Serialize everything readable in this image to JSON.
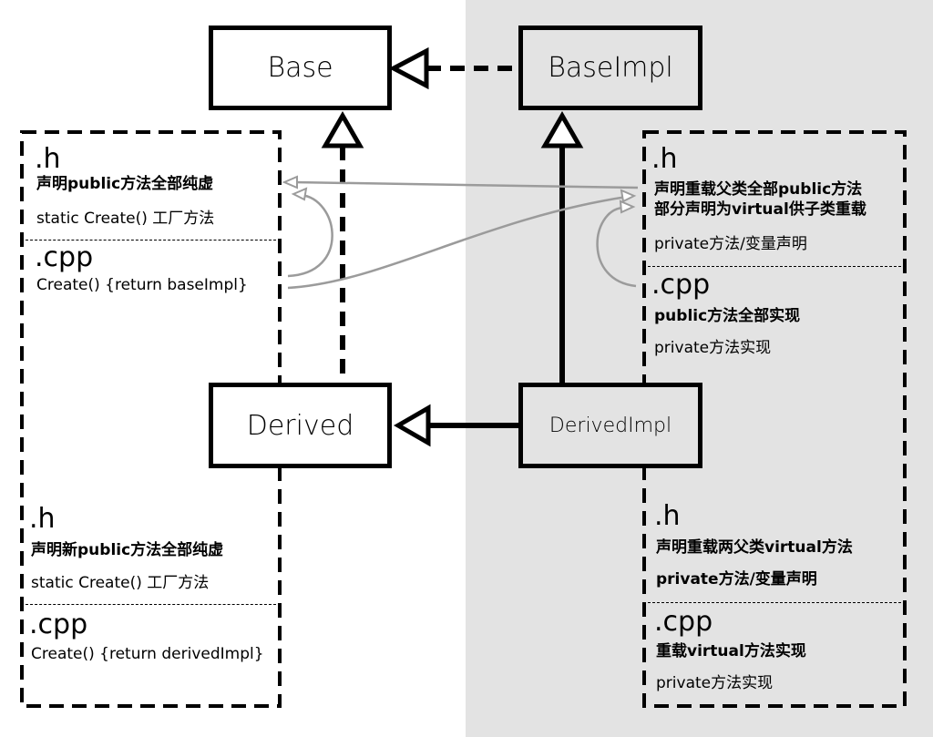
{
  "classes": {
    "base": "Base",
    "base_impl": "BaseImpl",
    "derived": "Derived",
    "derived_impl": "DerivedImpl"
  },
  "base_note": {
    "h_ext": ".h",
    "h_line1": "声明public方法全部纯虚",
    "h_line2": "static Create() 工厂方法",
    "cpp_ext": ".cpp",
    "cpp_line1": "Create() {return baseImpl}"
  },
  "base_impl_note": {
    "h_ext": ".h",
    "h_line1": "声明重载父类全部public方法",
    "h_line2": "部分声明为virtual供子类重载",
    "h_line3": "private方法/变量声明",
    "cpp_ext": ".cpp",
    "cpp_line1": "public方法全部实现",
    "cpp_line2": "private方法实现"
  },
  "derived_note": {
    "h_ext": ".h",
    "h_line1": "声明新public方法全部纯虚",
    "h_line2": "static Create() 工厂方法",
    "cpp_ext": ".cpp",
    "cpp_line1": "Create() {return derivedImpl}"
  },
  "derived_impl_note": {
    "h_ext": ".h",
    "h_line1": "声明重载两父类virtual方法",
    "h_line2": "private方法/变量声明",
    "cpp_ext": ".cpp",
    "cpp_line1": "重载virtual方法实现",
    "cpp_line2": "private方法实现"
  },
  "colors": {
    "impl_background": "#e3e3e3",
    "arrow": "#000000",
    "reference_arrow": "#999999"
  }
}
